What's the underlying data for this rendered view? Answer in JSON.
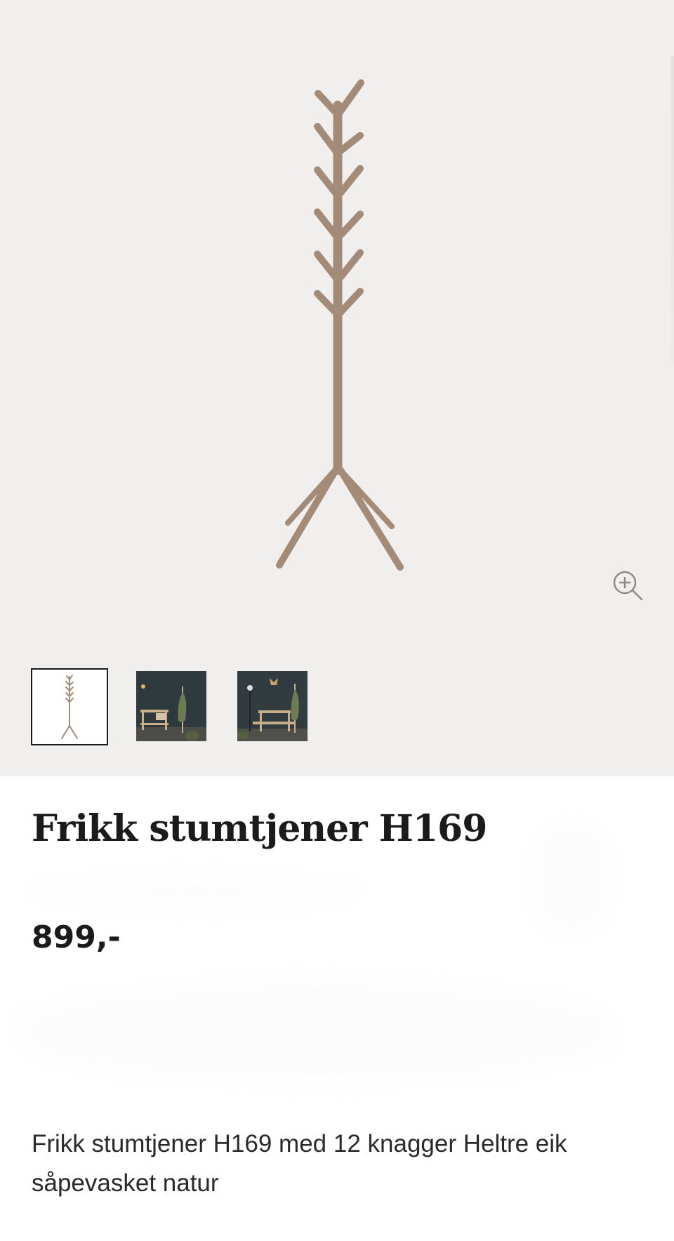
{
  "product": {
    "title": "Frikk stumtjener H169",
    "price": "899,-",
    "description": "Frikk stumtjener H169 med 12 knagger Heltre eik såpevasket natur"
  },
  "gallery": {
    "zoom_icon": "zoom-in-icon",
    "thumbnails": [
      {
        "name": "thumbnail-product-white",
        "active": true
      },
      {
        "name": "thumbnail-room-scene-1",
        "active": false
      },
      {
        "name": "thumbnail-room-scene-2",
        "active": false
      }
    ]
  },
  "colors": {
    "wood": "#a38a77",
    "gallery_bg": "#f1efed",
    "text": "#1b1b1b"
  }
}
